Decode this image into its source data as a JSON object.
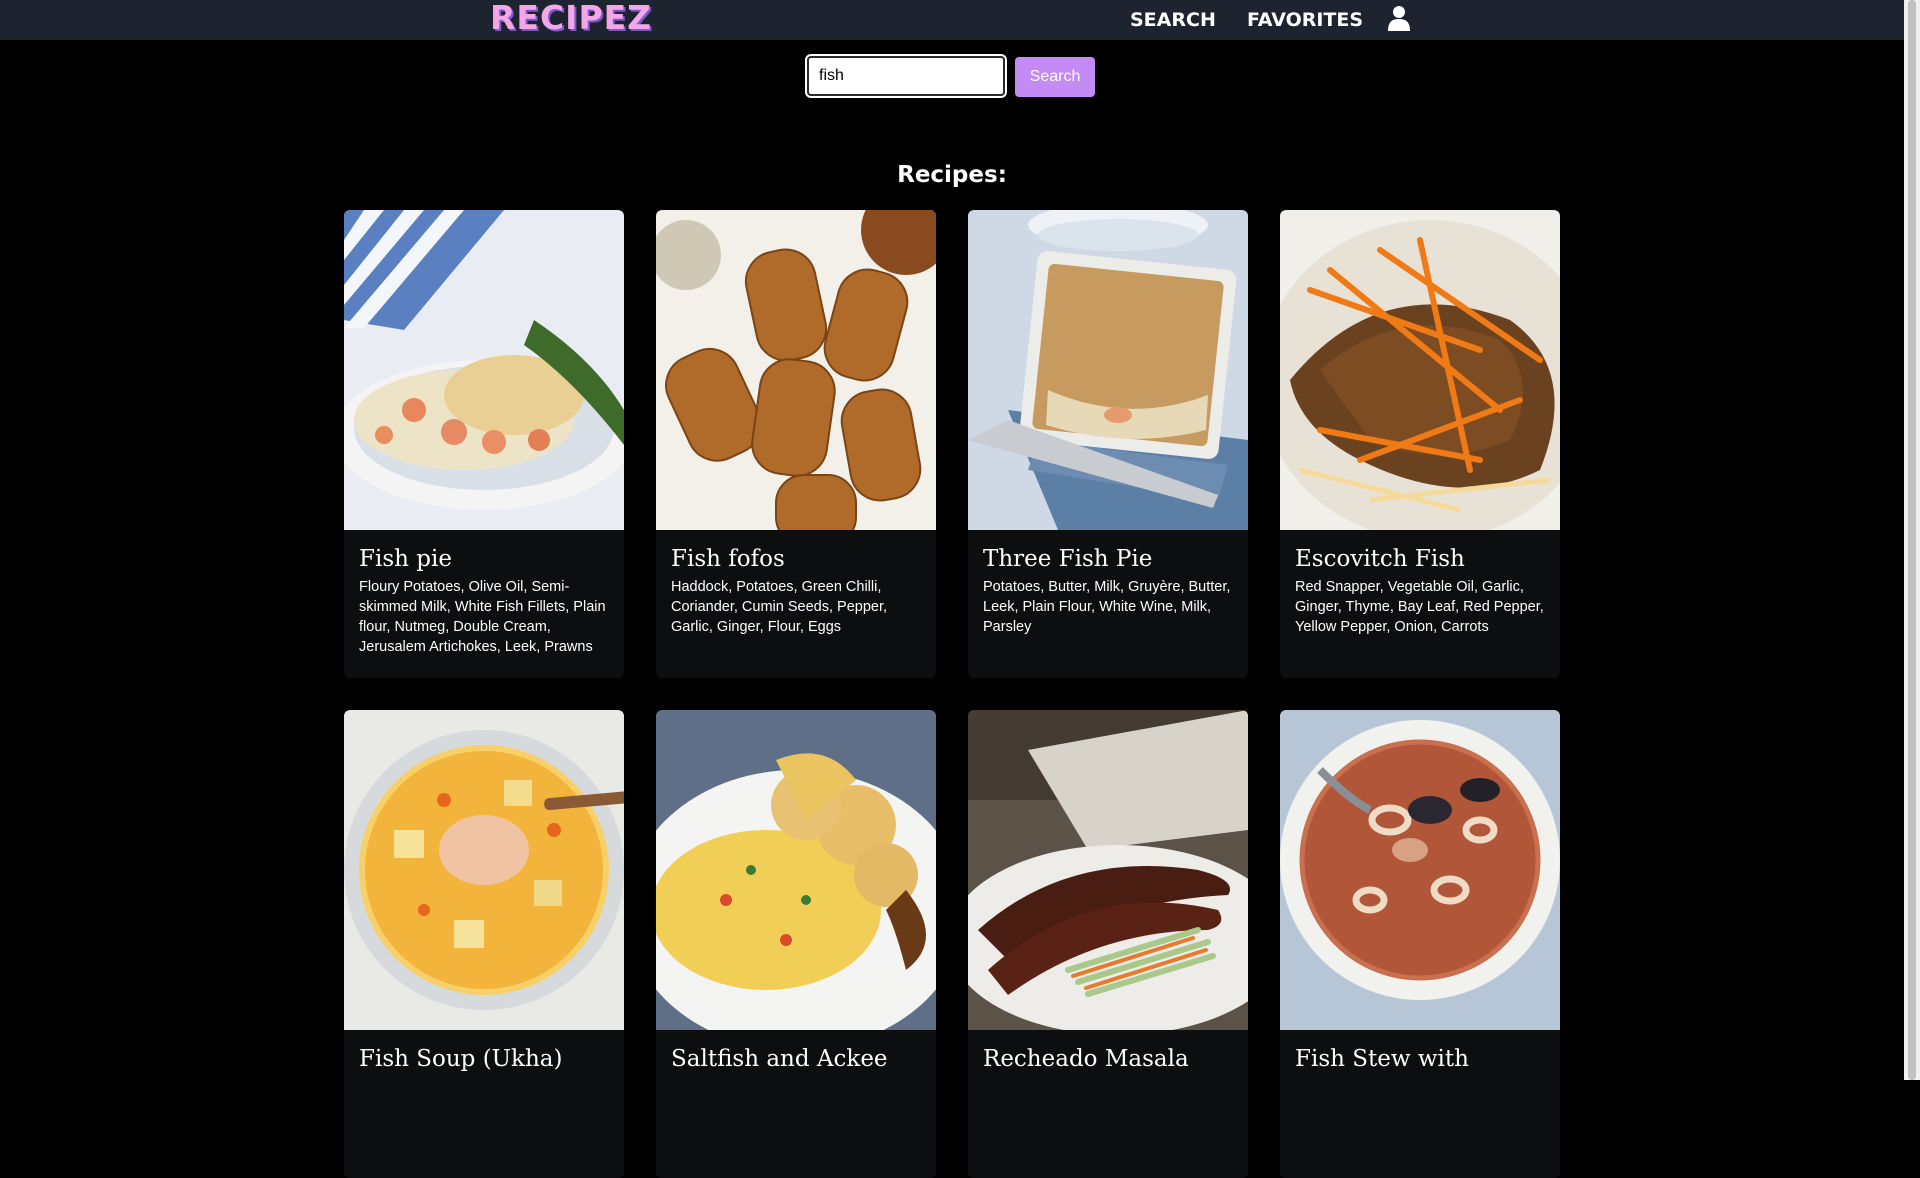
{
  "header": {
    "logo": "RECIPEZ",
    "nav": [
      "SEARCH",
      "FAVORITES"
    ]
  },
  "search": {
    "value": "fish",
    "button": "Search"
  },
  "section_title": "Recipes:",
  "recipes": [
    {
      "title": "Fish pie",
      "ingredients": "Floury Potatoes, Olive Oil, Semi-skimmed Milk, White Fish Fillets, Plain flour, Nutmeg, Double Cream, Jerusalem Artichokes, Leek, Prawns"
    },
    {
      "title": "Fish fofos",
      "ingredients": "Haddock, Potatoes, Green Chilli, Coriander, Cumin Seeds, Pepper, Garlic, Ginger, Flour, Eggs"
    },
    {
      "title": "Three Fish Pie",
      "ingredients": "Potatoes, Butter, Milk, Gruyère, Butter, Leek, Plain Flour, White Wine, Milk, Parsley"
    },
    {
      "title": "Escovitch Fish",
      "ingredients": "Red Snapper, Vegetable Oil, Garlic, Ginger, Thyme, Bay Leaf, Red Pepper, Yellow Pepper, Onion, Carrots"
    },
    {
      "title": "Fish Soup (Ukha)",
      "ingredients": ""
    },
    {
      "title": "Saltfish and Ackee",
      "ingredients": ""
    },
    {
      "title": "Recheado Masala",
      "ingredients": ""
    },
    {
      "title": "Fish Stew with",
      "ingredients": ""
    }
  ],
  "colors": {
    "navbar": "#1e2330",
    "accent": "#c48af5",
    "logo": "#f4a6e8",
    "card": "#0d0e10"
  }
}
